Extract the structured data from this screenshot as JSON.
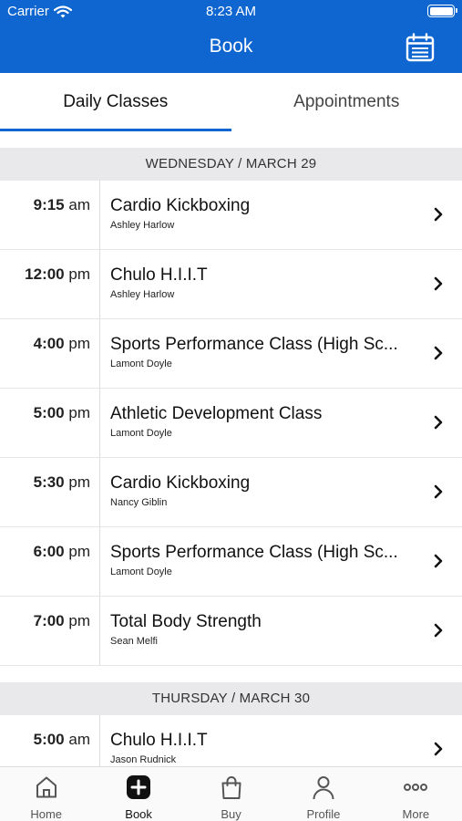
{
  "status_bar": {
    "carrier": "Carrier",
    "time": "8:23 AM"
  },
  "nav": {
    "title": "Book",
    "calendar_icon": "calendar-icon"
  },
  "tabs": [
    {
      "label": "Daily Classes",
      "active": true
    },
    {
      "label": "Appointments",
      "active": false
    }
  ],
  "days": [
    {
      "header": "WEDNESDAY / MARCH 29",
      "classes": [
        {
          "time": "9:15",
          "ampm": "am",
          "title": "Cardio Kickboxing",
          "instructor": "Ashley Harlow"
        },
        {
          "time": "12:00",
          "ampm": "pm",
          "title": "Chulo H.I.I.T",
          "instructor": "Ashley Harlow"
        },
        {
          "time": "4:00",
          "ampm": "pm",
          "title": "Sports Performance Class (High Sc...",
          "instructor": "Lamont Doyle"
        },
        {
          "time": "5:00",
          "ampm": "pm",
          "title": "Athletic Development Class",
          "instructor": "Lamont Doyle"
        },
        {
          "time": "5:30",
          "ampm": "pm",
          "title": "Cardio Kickboxing",
          "instructor": "Nancy Giblin"
        },
        {
          "time": "6:00",
          "ampm": "pm",
          "title": "Sports Performance Class (High Sc...",
          "instructor": "Lamont Doyle"
        },
        {
          "time": "7:00",
          "ampm": "pm",
          "title": "Total Body Strength",
          "instructor": "Sean Melfi"
        }
      ]
    },
    {
      "header": "THURSDAY / MARCH 30",
      "classes": [
        {
          "time": "5:00",
          "ampm": "am",
          "title": "Chulo H.I.I.T",
          "instructor": "Jason Rudnick"
        }
      ]
    }
  ],
  "tabbar": [
    {
      "label": "Home",
      "icon": "home-icon",
      "active": false
    },
    {
      "label": "Book",
      "icon": "plus-square-icon",
      "active": true
    },
    {
      "label": "Buy",
      "icon": "shopping-bag-icon",
      "active": false
    },
    {
      "label": "Profile",
      "icon": "person-icon",
      "active": false
    },
    {
      "label": "More",
      "icon": "more-icon",
      "active": false
    }
  ],
  "colors": {
    "brand": "#0f66d0",
    "section_bg": "#e9e9eb"
  }
}
